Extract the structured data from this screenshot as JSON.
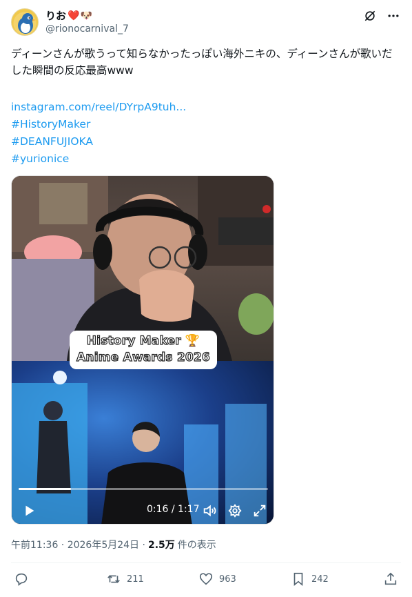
{
  "user": {
    "display_name": "りお",
    "badge_emojis": "❤️🐶",
    "handle": "@rionocarnival_7",
    "avatar_icon": "penguin-avatar-icon"
  },
  "header_icons": [
    "grok-icon",
    "more-icon"
  ],
  "tweet": {
    "text": "ディーンさんが歌うって知らなかったっぽい海外ニキの、ディーンさんが歌いだした瞬間の反応最高www",
    "link": "instagram.com/reel/DYrpA9tuh...",
    "hashtags": [
      "#HistoryMaker",
      "#DEANFUJIOKA",
      "#yurionice"
    ]
  },
  "video": {
    "overlay_line1": "History Maker 🏆",
    "overlay_line2": "Anime Awards 2026",
    "time_display": "0:16 / 1:17",
    "progress_fraction": 0.21,
    "controls": [
      "play-icon",
      "volume-icon",
      "settings-icon",
      "fullscreen-icon"
    ]
  },
  "meta": {
    "timestamp": "午前11:36 · 2026年5月24日 · ",
    "views_count": "2.5万",
    "views_label": "件の表示"
  },
  "actions": {
    "reply_count": "",
    "retweet_count": "211",
    "like_count": "963",
    "bookmark_count": "242"
  },
  "colors": {
    "link": "#1d9bf0",
    "secondary_text": "#536471"
  }
}
